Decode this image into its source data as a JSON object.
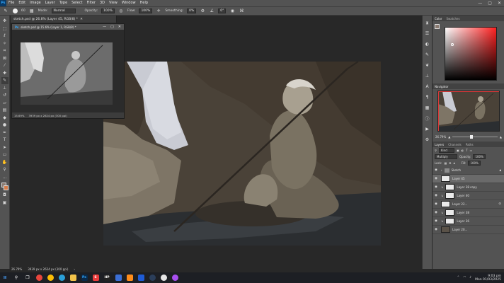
{
  "menubar": {
    "app_logo": "Ps",
    "items": [
      "File",
      "Edit",
      "Image",
      "Layer",
      "Type",
      "Select",
      "Filter",
      "3D",
      "View",
      "Window",
      "Help"
    ],
    "window_controls": [
      "—",
      "▢",
      "✕"
    ]
  },
  "options": {
    "brush_size": "60",
    "mode_label": "Mode:",
    "mode_value": "Normal",
    "opacity_label": "Opacity:",
    "opacity_value": "100%",
    "flow_label": "Flow:",
    "flow_value": "100%",
    "smoothing_label": "Smoothing:",
    "smoothing_value": "0%",
    "angle_value": "0°"
  },
  "document": {
    "tab_title": "sketch.psd @ 26.8% (Layer 45, RGB/8) *",
    "zoom": "26.79%",
    "doc_size": "3939 px x 2624 px (300 ppi)"
  },
  "float_window": {
    "title": "sketch.psd @ 15.6% (Layer 1, RGB/8) *",
    "zoom": "15.69%",
    "size": "3939 px x 2624 px (300 ppi)"
  },
  "panels": {
    "color_tabs": [
      "Color",
      "Swatches"
    ],
    "navigator_tabs": [
      "Navigator"
    ],
    "navigator_zoom": "26.79%",
    "layers_tabs": [
      "Layers",
      "Channels",
      "Paths"
    ],
    "kind_label": "Kind",
    "blend_mode": "Multiply",
    "opacity_label": "Opacity:",
    "opacity_value": "100%",
    "lock_label": "Lock:",
    "fill_label": "Fill:",
    "fill_value": "100%"
  },
  "layers": [
    {
      "name": "Sketch",
      "type": "folder",
      "selected": false,
      "locked": true
    },
    {
      "name": "Layer 45",
      "type": "layer",
      "selected": true,
      "locked": false
    },
    {
      "name": "Layer 38 copy",
      "type": "layer",
      "selected": false,
      "locked": false
    },
    {
      "name": "Layer 40",
      "type": "layer",
      "selected": false,
      "locked": false
    },
    {
      "name": "Layer 22...",
      "type": "layer",
      "selected": false,
      "locked": false
    },
    {
      "name": "Layer 38",
      "type": "layer",
      "selected": false,
      "locked": false
    },
    {
      "name": "Layer 36",
      "type": "layer",
      "selected": false,
      "locked": false
    },
    {
      "name": "Layer 20...",
      "type": "layer",
      "selected": false,
      "locked": false
    }
  ],
  "taskbar": {
    "time": "9:03 pm",
    "date": "Mon 01/03/2025",
    "apps": [
      "Ps",
      "S",
      "HP"
    ]
  },
  "colors": {
    "photoshop_blue": "#31a8ff",
    "nav_frame": "#e03a3a",
    "canvas_base": "#4b4339"
  }
}
